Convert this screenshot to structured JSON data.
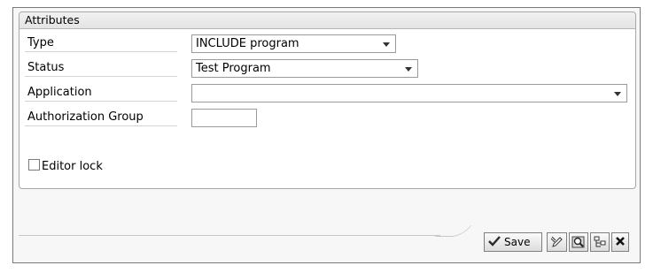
{
  "attributes": {
    "header": "Attributes",
    "type": {
      "label": "Type",
      "value": "INCLUDE program"
    },
    "status": {
      "label": "Status",
      "value": "Test Program"
    },
    "application": {
      "label": "Application",
      "value": ""
    },
    "authorization_group": {
      "label": "Authorization Group",
      "value": ""
    },
    "editor_lock": {
      "label": "Editor lock",
      "checked": false
    }
  },
  "toolbar": {
    "save_label": "Save",
    "icons": [
      "save-check-icon",
      "pencil-icon",
      "find-icon",
      "hierarchy-icon",
      "close-icon"
    ]
  }
}
